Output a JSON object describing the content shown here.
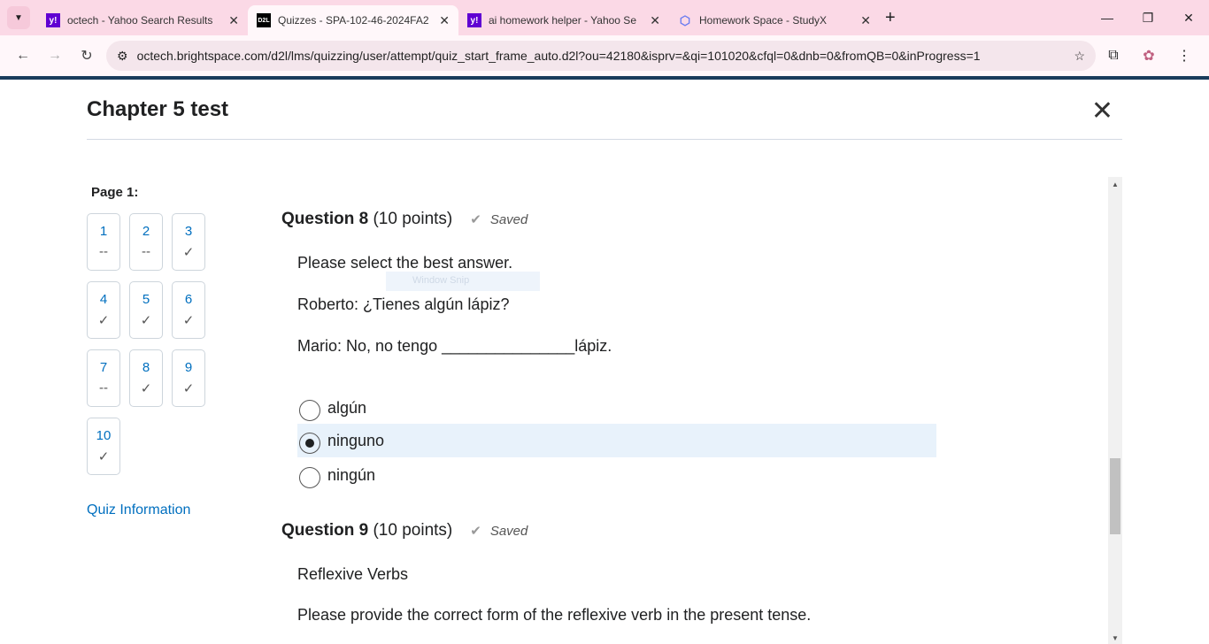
{
  "browser": {
    "tabs": [
      {
        "title": "octech - Yahoo Search Results",
        "favicon": "yahoo",
        "active": false
      },
      {
        "title": "Quizzes - SPA-102-46-2024FA2",
        "favicon": "d2l",
        "active": true
      },
      {
        "title": "ai homework helper - Yahoo Se",
        "favicon": "yahoo",
        "active": false
      },
      {
        "title": "Homework Space - StudyX",
        "favicon": "studyx",
        "active": false
      }
    ],
    "url": "octech.brightspace.com/d2l/lms/quizzing/user/attempt/quiz_start_frame_auto.d2l?ou=42180&isprv=&qi=101020&cfql=0&dnb=0&fromQB=0&inProgress=1"
  },
  "quiz": {
    "title": "Chapter 5 test",
    "page_label": "Page 1:",
    "questions_nav": [
      {
        "num": "1",
        "status": "--"
      },
      {
        "num": "2",
        "status": "--"
      },
      {
        "num": "3",
        "status": "✓"
      },
      {
        "num": "4",
        "status": "✓"
      },
      {
        "num": "5",
        "status": "✓"
      },
      {
        "num": "6",
        "status": "✓"
      },
      {
        "num": "7",
        "status": "--"
      },
      {
        "num": "8",
        "status": "✓"
      },
      {
        "num": "9",
        "status": "✓"
      },
      {
        "num": "10",
        "status": "✓"
      }
    ],
    "quiz_info_link": "Quiz Information",
    "q8": {
      "title": "Question 8",
      "points": "(10 points)",
      "saved": "Saved",
      "prompt": "Please select the best answer.",
      "line1": "Roberto: ¿Tienes algún lápiz?",
      "line2": "Mario: No, no tengo _______________lápiz.",
      "options": [
        "algún",
        "ninguno",
        "ningún"
      ],
      "selected": "ninguno"
    },
    "q9": {
      "title": "Question 9",
      "points": "(10 points)",
      "saved": "Saved",
      "topic": "Reflexive Verbs",
      "prompt": "Please provide the correct form of the reflexive verb in the present tense."
    }
  },
  "overlay": {
    "snip": "Window Snip"
  }
}
